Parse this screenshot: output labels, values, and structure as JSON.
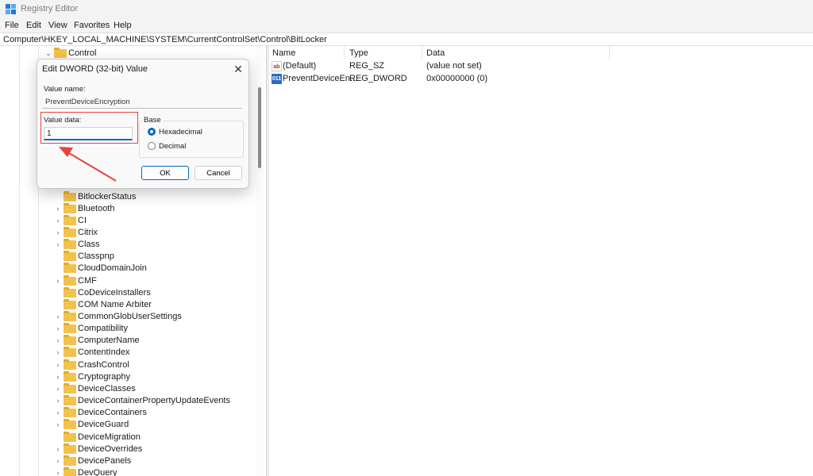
{
  "window": {
    "title": "Registry Editor",
    "app_icon": "registry-editor-icon"
  },
  "menu": [
    "File",
    "Edit",
    "View",
    "Favorites",
    "Help"
  ],
  "address": "Computer\\HKEY_LOCAL_MACHINE\\SYSTEM\\CurrentControlSet\\Control\\BitLocker",
  "tree": {
    "items": [
      {
        "label": "Control",
        "expanded": true
      },
      {
        "label": "BitlockerStatus",
        "has_children": false
      },
      {
        "label": "Bluetooth",
        "has_children": true
      },
      {
        "label": "CI",
        "has_children": true
      },
      {
        "label": "Citrix",
        "has_children": true
      },
      {
        "label": "Class",
        "has_children": true
      },
      {
        "label": "Classpnp",
        "has_children": false
      },
      {
        "label": "CloudDomainJoin",
        "has_children": false
      },
      {
        "label": "CMF",
        "has_children": true
      },
      {
        "label": "CoDeviceInstallers",
        "has_children": false
      },
      {
        "label": "COM Name Arbiter",
        "has_children": false
      },
      {
        "label": "CommonGlobUserSettings",
        "has_children": true
      },
      {
        "label": "Compatibility",
        "has_children": true
      },
      {
        "label": "ComputerName",
        "has_children": true
      },
      {
        "label": "ContentIndex",
        "has_children": true
      },
      {
        "label": "CrashControl",
        "has_children": true
      },
      {
        "label": "Cryptography",
        "has_children": true
      },
      {
        "label": "DeviceClasses",
        "has_children": true
      },
      {
        "label": "DeviceContainerPropertyUpdateEvents",
        "has_children": true
      },
      {
        "label": "DeviceContainers",
        "has_children": true
      },
      {
        "label": "DeviceGuard",
        "has_children": true
      },
      {
        "label": "DeviceMigration",
        "has_children": false
      },
      {
        "label": "DeviceOverrides",
        "has_children": true
      },
      {
        "label": "DevicePanels",
        "has_children": true
      },
      {
        "label": "DevQuery",
        "has_children": true
      }
    ]
  },
  "values": {
    "columns": [
      "Name",
      "Type",
      "Data"
    ],
    "rows": [
      {
        "icon": "string-value-icon",
        "icon_text": "ab",
        "name": "(Default)",
        "type": "REG_SZ",
        "data": "(value not set)"
      },
      {
        "icon": "dword-value-icon",
        "icon_text": "011",
        "name": "PreventDeviceEn...",
        "type": "REG_DWORD",
        "data": "0x00000000 (0)"
      }
    ]
  },
  "dialog": {
    "title": "Edit DWORD (32-bit) Value",
    "value_name_label": "Value name:",
    "value_name": "PreventDeviceEncryption",
    "value_data_label": "Value data:",
    "value_data": "1",
    "base_label": "Base",
    "hex_label": "Hexadecimal",
    "dec_label": "Decimal",
    "base_selected": "Hexadecimal",
    "ok_label": "OK",
    "cancel_label": "Cancel"
  },
  "colors": {
    "accent": "#0067c0",
    "annotation": "#e8433d",
    "folder": "#f3c24d"
  }
}
